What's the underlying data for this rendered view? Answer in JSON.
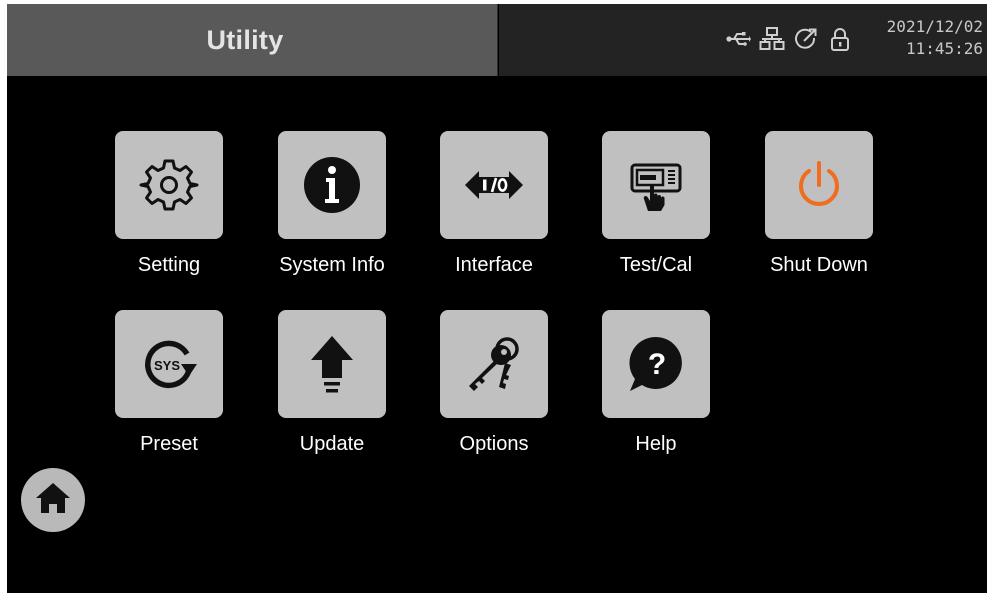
{
  "header": {
    "title": "Utility",
    "status_icons": [
      "usb-icon",
      "network-icon",
      "remote-icon",
      "lock-icon"
    ],
    "date": "2021/12/02",
    "time": "11:45:26"
  },
  "tiles": [
    {
      "label": "Setting",
      "icon": "gear-icon"
    },
    {
      "label": "System Info",
      "icon": "info-icon"
    },
    {
      "label": "Interface",
      "icon": "io-arrows-icon"
    },
    {
      "label": "Test/Cal",
      "icon": "touch-panel-icon"
    },
    {
      "label": "Shut Down",
      "icon": "power-icon"
    },
    {
      "label": "Preset",
      "icon": "sys-preset-icon"
    },
    {
      "label": "Update",
      "icon": "upload-arrow-icon"
    },
    {
      "label": "Options",
      "icon": "keys-icon"
    },
    {
      "label": "Help",
      "icon": "help-bubble-icon"
    }
  ],
  "home": {
    "icon": "home-icon"
  },
  "colors": {
    "title_bar": "#595959",
    "status_bar": "#232323",
    "tile": "#c0c0c0",
    "power_accent": "#f06d1f",
    "background": "#000000"
  }
}
